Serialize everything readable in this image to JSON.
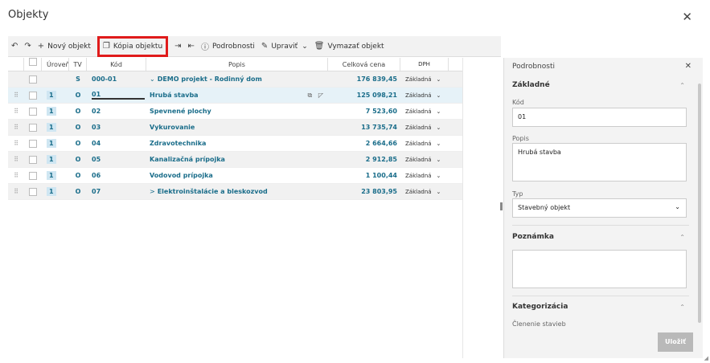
{
  "dialog": {
    "title": "Objekty"
  },
  "toolbar": {
    "undo_icon": "undo-icon",
    "redo_icon": "redo-icon",
    "new_object": "Nový objekt",
    "copy_object": "Kópia objektu",
    "details": "Podrobnosti",
    "edit": "Upraviť",
    "delete_object": "Vymazať objekt"
  },
  "grid": {
    "columns": {
      "level": "Úroveň",
      "tv": "TV",
      "kod": "Kód",
      "popis": "Popis",
      "cena": "Celková cena",
      "dph": "DPH"
    },
    "rows": [
      {
        "level": "",
        "tv": "S",
        "kod": "000-01",
        "popis": "DEMO projekt - Rodinný dom",
        "cena": "176 839,45",
        "dph": "Základná",
        "caret": "⌄",
        "style": "alt"
      },
      {
        "level": "1",
        "tv": "O",
        "kod": "01",
        "popis": "Hrubá stavba",
        "cena": "125 098,21",
        "dph": "Základná",
        "caret": "",
        "style": "sel"
      },
      {
        "level": "1",
        "tv": "O",
        "kod": "02",
        "popis": "Spevnené plochy",
        "cena": "7 523,60",
        "dph": "Základná",
        "caret": "",
        "style": ""
      },
      {
        "level": "1",
        "tv": "O",
        "kod": "03",
        "popis": "Vykurovanie",
        "cena": "13 735,74",
        "dph": "Základná",
        "caret": "",
        "style": "alt"
      },
      {
        "level": "1",
        "tv": "O",
        "kod": "04",
        "popis": "Zdravotechnika",
        "cena": "2 664,66",
        "dph": "Základná",
        "caret": "",
        "style": ""
      },
      {
        "level": "1",
        "tv": "O",
        "kod": "05",
        "popis": "Kanalizačná prípojka",
        "cena": "2 912,85",
        "dph": "Základná",
        "caret": "",
        "style": "alt"
      },
      {
        "level": "1",
        "tv": "O",
        "kod": "06",
        "popis": "Vodovod prípojka",
        "cena": "1 100,44",
        "dph": "Základná",
        "caret": "",
        "style": ""
      },
      {
        "level": "1",
        "tv": "O",
        "kod": "07",
        "popis": "Elektroinštalácie a bleskozvod",
        "cena": "23 803,95",
        "dph": "Základná",
        "caret": ">",
        "style": "alt"
      }
    ]
  },
  "panel": {
    "title": "Podrobnosti",
    "section_basic": "Základné",
    "kod_label": "Kód",
    "kod_value": "01",
    "popis_label": "Popis",
    "popis_value": "Hrubá stavba",
    "typ_label": "Typ",
    "typ_value": "Stavebný objekt",
    "section_note": "Poznámka",
    "note_value": "",
    "section_category": "Kategorizácia",
    "clenenie_label": "Členenie stavieb",
    "save": "Uložiť"
  }
}
